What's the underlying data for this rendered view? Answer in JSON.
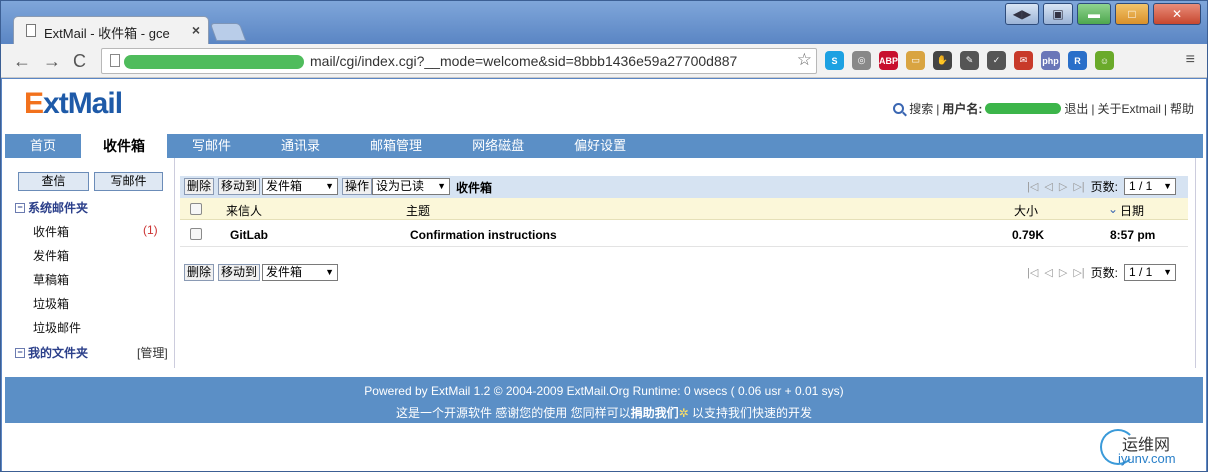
{
  "browser": {
    "tab_title": "ExtMail - 收件箱 - gce",
    "tab_close": "×",
    "url": "mail/cgi/index.cgi?__mode=welcome&sid=8bbb1436e59a27700d887",
    "back": "←",
    "forward": "→",
    "reload": "C",
    "star": "☆",
    "menu": "≡",
    "extensions": [
      {
        "name": "skype",
        "label": "S",
        "color": "#1da1e2"
      },
      {
        "name": "globe",
        "label": "◎",
        "color": "#888888"
      },
      {
        "name": "adblock",
        "label": "ABP",
        "color": "#c8102e"
      },
      {
        "name": "notes",
        "label": "▭",
        "color": "#d9a441"
      },
      {
        "name": "hand",
        "label": "✋",
        "color": "#444444"
      },
      {
        "name": "pin",
        "label": "✎",
        "color": "#555555"
      },
      {
        "name": "pocket",
        "label": "✓",
        "color": "#555555"
      },
      {
        "name": "pdf",
        "label": "✉",
        "color": "#c83a2a"
      },
      {
        "name": "php",
        "label": "php",
        "color": "#6a76b8"
      },
      {
        "name": "code",
        "label": "R",
        "color": "#2a6fc9"
      },
      {
        "name": "face",
        "label": "☺",
        "color": "#6aaa2a"
      }
    ]
  },
  "header": {
    "logo_e": "E",
    "logo_rest": "xtMail",
    "search": "搜索",
    "sep": "|",
    "user_label": "用户名:",
    "logout": "退出",
    "about": "关于Extmail",
    "help": "帮助"
  },
  "nav": [
    "首页",
    "收件箱",
    "写邮件",
    "通讯录",
    "邮箱管理",
    "网络磁盘",
    "偏好设置"
  ],
  "sidebar": {
    "check_mail": "查信",
    "compose": "写邮件",
    "system_folders": "系统邮件夹",
    "folders": [
      {
        "name": "收件箱",
        "unread": "(1)"
      },
      {
        "name": "发件箱",
        "unread": ""
      },
      {
        "name": "草稿箱",
        "unread": ""
      },
      {
        "name": "垃圾箱",
        "unread": ""
      },
      {
        "name": "垃圾邮件",
        "unread": ""
      }
    ],
    "my_folders": "我的文件夹",
    "manage": "[管理]"
  },
  "list": {
    "delete": "删除",
    "move_to": "移动到",
    "move_target": "发件箱",
    "action": "操作",
    "mark_as": "设为已读",
    "folder_title": "收件箱",
    "pages_label": "页数:",
    "page_value": "1 / 1",
    "columns": {
      "sender": "来信人",
      "subject": "主题",
      "size": "大小",
      "date": "日期"
    },
    "rows": [
      {
        "sender": "GitLab",
        "subject": "Confirmation instructions",
        "size": "0.79K",
        "date": "8:57 pm"
      }
    ]
  },
  "footer": {
    "line1": "Powered by ExtMail 1.2 © 2004-2009 ExtMail.Org Runtime: 0 wsecs ( 0.06 usr + 0.01 sys)",
    "line2_a": "这是一个开源软件 感谢您的使用 您同样可以",
    "line2_b": "捐助我们",
    "line2_c": " 以支持我们快速的开发"
  },
  "watermark": {
    "cn": "运维网",
    "en": "iyunv.com"
  }
}
